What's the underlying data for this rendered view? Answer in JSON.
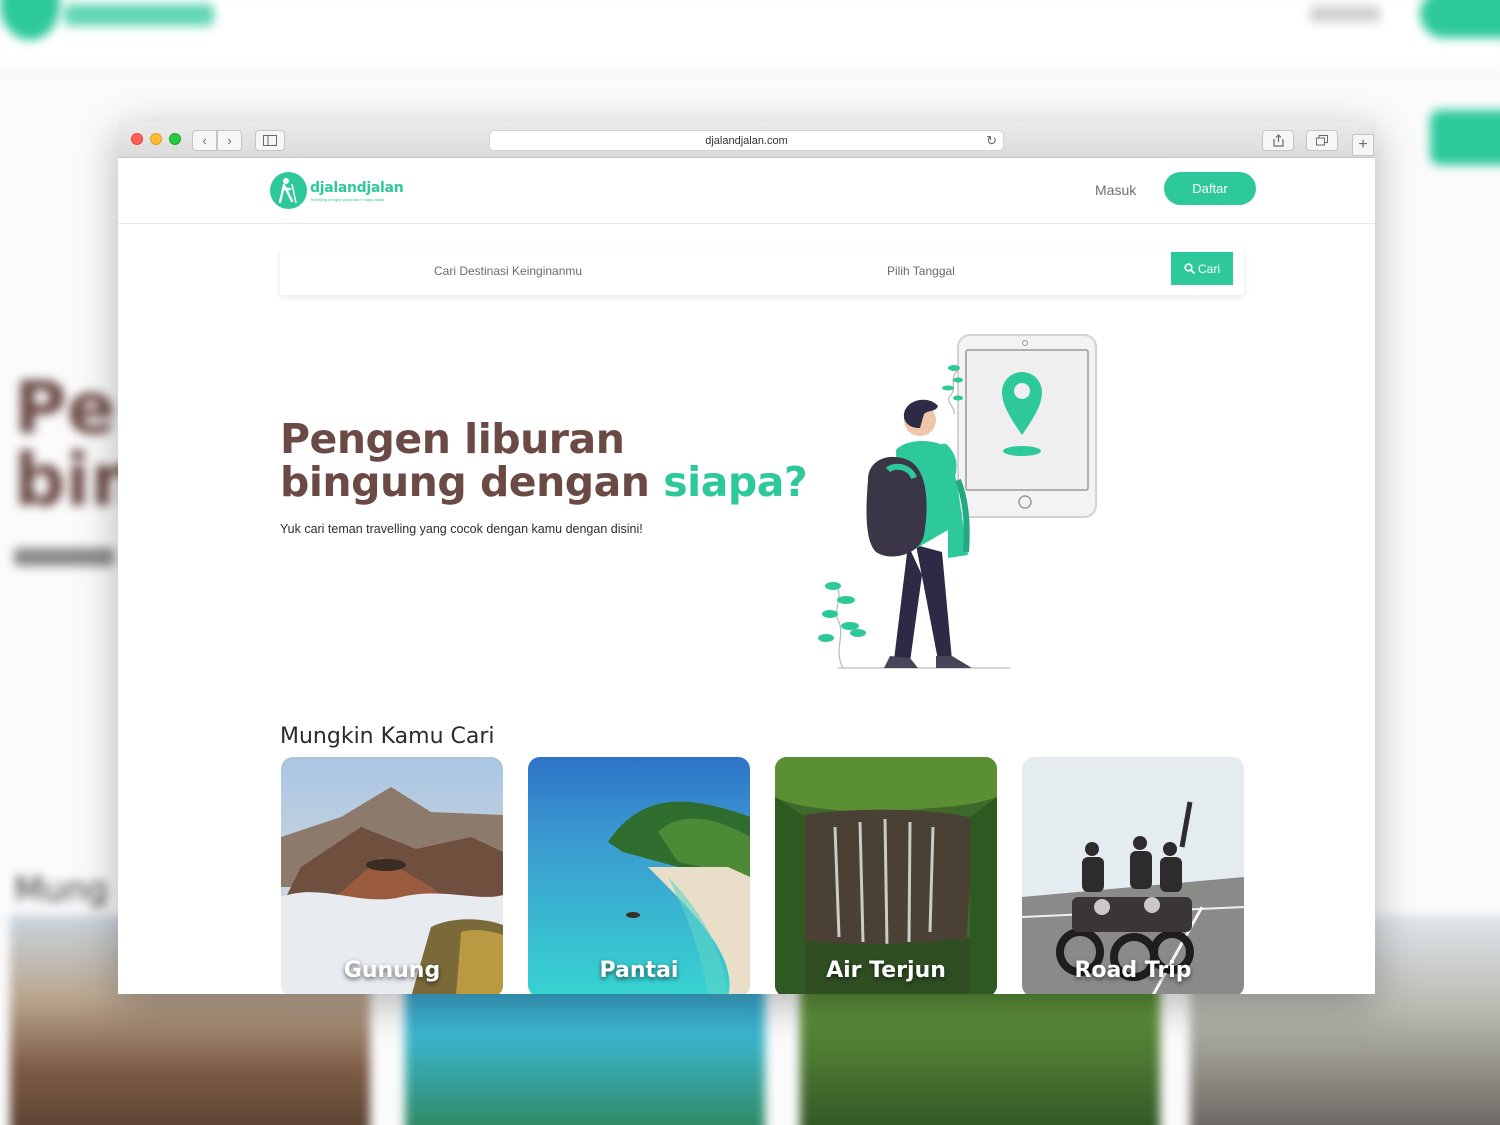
{
  "browser": {
    "url": "djalandjalan.com"
  },
  "header": {
    "logo_name": "djalandjalan",
    "logo_tagline": "Travelling dengan yang baru? siapa takut!",
    "masuk_label": "Masuk",
    "daftar_label": "Daftar"
  },
  "search": {
    "destination_placeholder": "Cari Destinasi Keinginanmu",
    "date_placeholder": "Pilih Tanggal",
    "button_label": "Cari"
  },
  "hero": {
    "title_line1": "Pengen liburan",
    "title_line2": "bingung dengan ",
    "title_accent": "siapa?",
    "subtitle": "Yuk cari teman travelling yang cocok dengan kamu dengan disini!"
  },
  "section": {
    "title": "Mungkin Kamu Cari",
    "cards": [
      {
        "label": "Gunung"
      },
      {
        "label": "Pantai"
      },
      {
        "label": "Air Terjun"
      },
      {
        "label": "Road Trip"
      }
    ]
  },
  "backdrop": {
    "heading": "Pe\nbin",
    "section_title": "Mung"
  },
  "colors": {
    "accent": "#2ec99b",
    "heading": "#6b4a45"
  }
}
